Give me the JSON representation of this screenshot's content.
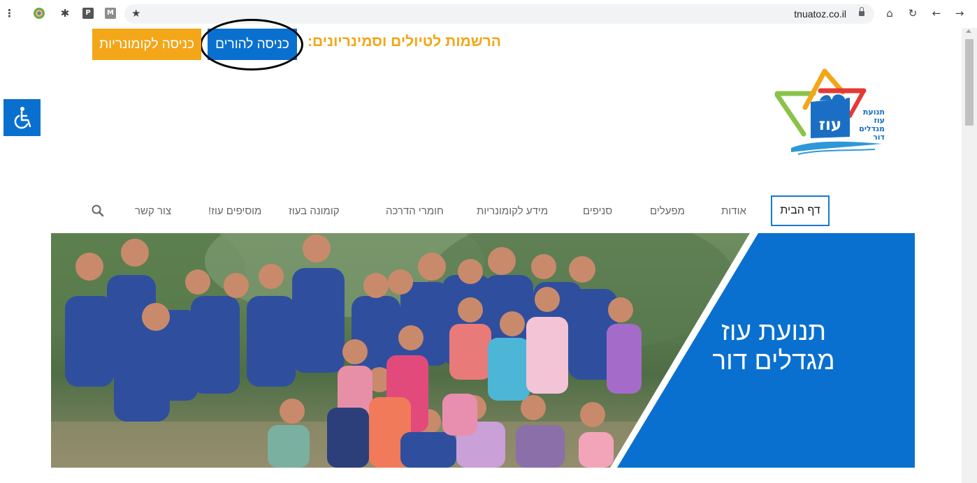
{
  "browser": {
    "url": "tnuatoz.co.il",
    "icons": [
      "menu-icon",
      "extension-icon",
      "puzzle-icon",
      "p-icon",
      "m-icon",
      "star-icon",
      "lock-icon",
      "home-icon",
      "reload-icon",
      "back-icon",
      "forward-icon"
    ],
    "ext_p": "P",
    "ext_m": "M"
  },
  "header": {
    "registration_text": "הרשמות לטיולים וסמינריונים:",
    "parents_button": "כניסה להורים",
    "communards_button": "כניסה לקומונריות"
  },
  "logo": {
    "word_main": "עוז",
    "lines": [
      "תנועת",
      "עוז",
      "מגדלים",
      "דור"
    ]
  },
  "nav": {
    "items": [
      "דף הבית",
      "אודות",
      "מפעלים",
      "סניפים",
      "מידע לקומונריות",
      "חומרי הדרכה",
      "קומונה בעוז",
      "מוסיפים עוז!",
      "צור קשר"
    ]
  },
  "hero": {
    "line1": "תנועת עוז",
    "line2": "מגדלים דור"
  },
  "colors": {
    "brand_blue": "#0a70cf",
    "accent_orange": "#f3a617",
    "nav_text": "#666666"
  }
}
